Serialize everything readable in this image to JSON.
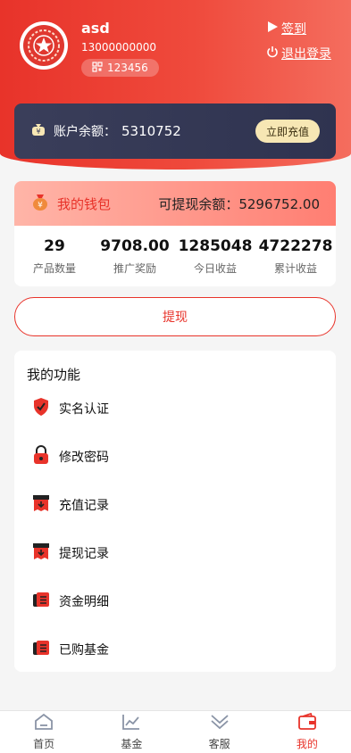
{
  "user": {
    "name": "asd",
    "phone": "13000000000",
    "invite_code": "123456"
  },
  "header": {
    "checkin_label": "签到",
    "logout_label": "退出登录"
  },
  "balance": {
    "label": "账户余额：",
    "value": "5310752",
    "recharge_label": "立即充值"
  },
  "wallet": {
    "title": "我的钱包",
    "withdrawable_label": "可提现余额：",
    "withdrawable_value": "5296752.00",
    "stats": [
      {
        "value": "29",
        "label": "产品数量"
      },
      {
        "value": "9708.00",
        "label": "推广奖励"
      },
      {
        "value": "1285048",
        "label": "今日收益"
      },
      {
        "value": "4722278",
        "label": "累计收益"
      }
    ]
  },
  "withdraw_button": "提现",
  "functions": {
    "title": "我的功能",
    "items": [
      {
        "label": "实名认证",
        "icon": "shield-check-icon"
      },
      {
        "label": "修改密码",
        "icon": "lock-icon"
      },
      {
        "label": "充值记录",
        "icon": "recharge-record-icon"
      },
      {
        "label": "提现记录",
        "icon": "withdraw-record-icon"
      },
      {
        "label": "资金明细",
        "icon": "ledger-icon"
      },
      {
        "label": "已购基金",
        "icon": "fund-icon"
      }
    ]
  },
  "tabbar": {
    "items": [
      {
        "label": "首页",
        "icon": "home-icon"
      },
      {
        "label": "基金",
        "icon": "chart-icon"
      },
      {
        "label": "客服",
        "icon": "service-icon"
      },
      {
        "label": "我的",
        "icon": "wallet-icon"
      }
    ],
    "active_index": 3
  },
  "colors": {
    "accent": "#e8332a",
    "card_dark": "#3a3e5a",
    "gold": "#f7e7b4"
  }
}
